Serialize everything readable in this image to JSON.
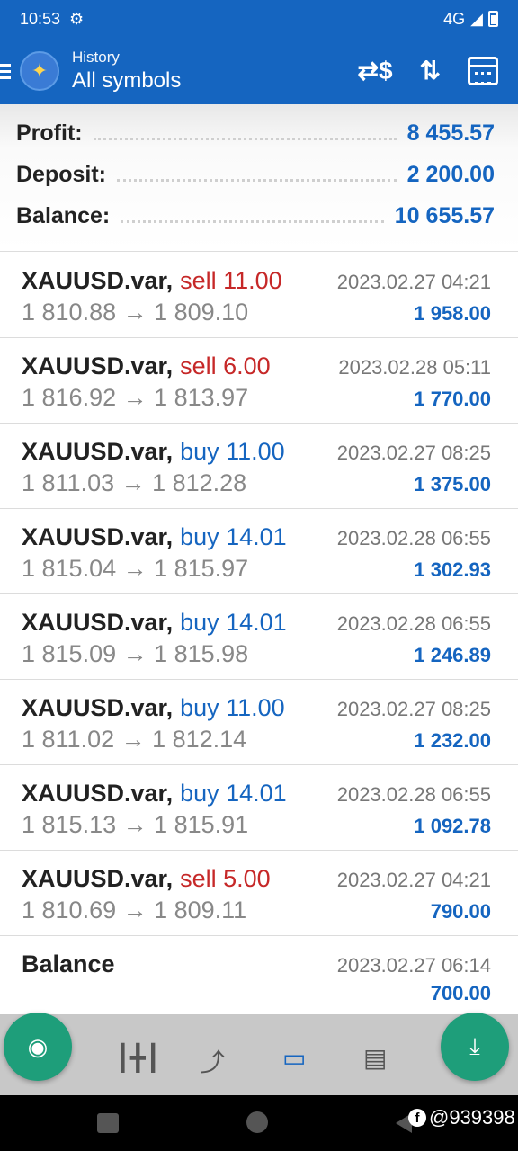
{
  "status_bar": {
    "time": "10:53",
    "network": "4G"
  },
  "header": {
    "subtitle": "History",
    "title": "All symbols"
  },
  "summary": [
    {
      "label": "Profit:",
      "value": "8 455.57"
    },
    {
      "label": "Deposit:",
      "value": "2 200.00"
    },
    {
      "label": "Balance:",
      "value": "10 655.57"
    }
  ],
  "deals": [
    {
      "symbol": "XAUUSD.var,",
      "dir": "sell",
      "volume": "sell 11.00",
      "time": "2023.02.27 04:21",
      "prices": "1 810.88 → 1 809.10",
      "profit": "1 958.00"
    },
    {
      "symbol": "XAUUSD.var,",
      "dir": "sell",
      "volume": "sell 6.00",
      "time": "2023.02.28 05:11",
      "prices": "1 816.92 → 1 813.97",
      "profit": "1 770.00"
    },
    {
      "symbol": "XAUUSD.var,",
      "dir": "buy",
      "volume": "buy 11.00",
      "time": "2023.02.27 08:25",
      "prices": "1 811.03 → 1 812.28",
      "profit": "1 375.00"
    },
    {
      "symbol": "XAUUSD.var,",
      "dir": "buy",
      "volume": "buy 14.01",
      "time": "2023.02.28 06:55",
      "prices": "1 815.04 → 1 815.97",
      "profit": "1 302.93"
    },
    {
      "symbol": "XAUUSD.var,",
      "dir": "buy",
      "volume": "buy 14.01",
      "time": "2023.02.28 06:55",
      "prices": "1 815.09 → 1 815.98",
      "profit": "1 246.89"
    },
    {
      "symbol": "XAUUSD.var,",
      "dir": "buy",
      "volume": "buy 11.00",
      "time": "2023.02.27 08:25",
      "prices": "1 811.02 → 1 812.14",
      "profit": "1 232.00"
    },
    {
      "symbol": "XAUUSD.var,",
      "dir": "buy",
      "volume": "buy 14.01",
      "time": "2023.02.28 06:55",
      "prices": "1 815.13 → 1 815.91",
      "profit": "1 092.78"
    },
    {
      "symbol": "XAUUSD.var,",
      "dir": "sell",
      "volume": "sell 5.00",
      "time": "2023.02.27 04:21",
      "prices": "1 810.69 → 1 809.11",
      "profit": "790.00"
    },
    {
      "symbol": "Balance",
      "dir": "",
      "volume": "",
      "time": "2023.02.27 06:14",
      "prices": "",
      "profit": "700.00"
    }
  ],
  "watermark": {
    "icon": "f",
    "text": "@939398"
  },
  "colors": {
    "brand": "#1565c0",
    "sell": "#c62828",
    "buy": "#1565c0",
    "fab": "#1e9e7a"
  }
}
